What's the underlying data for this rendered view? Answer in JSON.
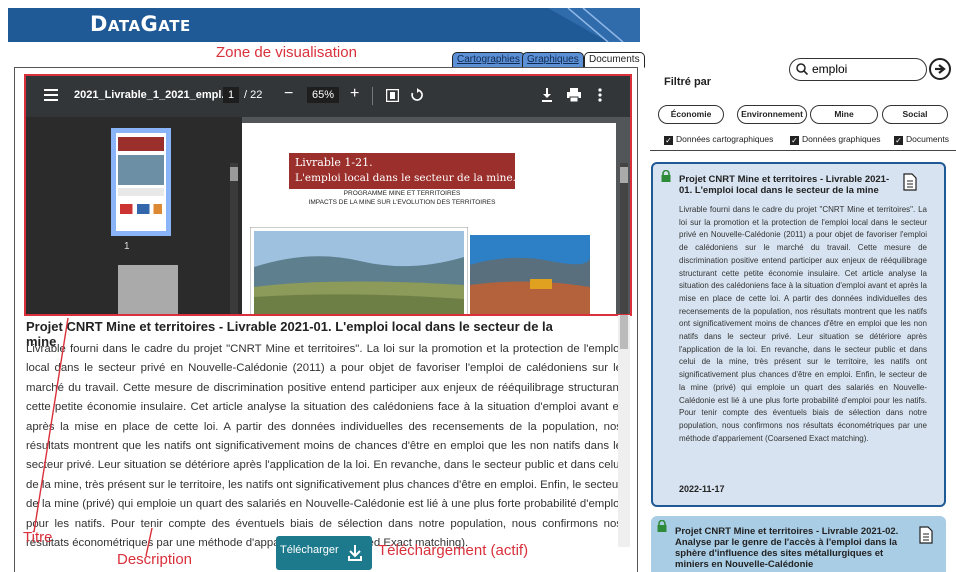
{
  "header": {
    "logo": "DataGate"
  },
  "tabs": [
    {
      "label": "Cartographies"
    },
    {
      "label": "Graphiques"
    },
    {
      "label": "Documents"
    }
  ],
  "annotations": {
    "zone": "Zone de visualisation",
    "titre": "Titre",
    "description": "Description",
    "telechargement": "Téléchargement (actif)"
  },
  "pdf_viewer": {
    "menu_icon": "hamburger-icon",
    "filename": "2021_Livrable_1_2021_empl...",
    "page_current": "1",
    "page_total": "/ 22",
    "zoom": "65%",
    "thumbnail_page": "1",
    "page_banner_line1": "Livrable 1-21.",
    "page_banner_line2": "L'emploi local dans le secteur de la mine.",
    "page_sub1": "PROGRAMME MINE ET TERRITOIRES",
    "page_sub2": "IMPACTS DE LA MINE SUR L'EVOLUTION DES TERRITOIRES",
    "banner_color": "#9b2f2c"
  },
  "document": {
    "title": "Projet CNRT Mine et territoires - Livrable 2021-01. L'emploi local dans le secteur de la mine",
    "description": "Livrable fourni dans le cadre du projet \"CNRT Mine et territoires\". La loi sur la promotion et la protection de l'emploi local dans le secteur privé en Nouvelle-Calédonie (2011) a pour objet de favoriser l'emploi de calédoniens sur le marché du travail. Cette mesure de discrimination positive entend participer aux enjeux de rééquilibrage structurant cette petite économie insulaire. Cet article analyse la situation des calédoniens face à la situation d'emploi avant et après la mise en place de cette loi. A partir des données individuelles des recensements de la population, nos résultats montrent que les natifs ont significativement moins de chances d'être en emploi que les non natifs dans le secteur privé. Leur situation se détériore après l'application de la loi. En revanche, dans le secteur public et dans celui de la mine, très présent sur le territoire, les natifs ont significativement plus chances d'être en emploi. Enfin, le secteur de la mine (privé) qui emploie un quart des salariés en Nouvelle-Calédonie est lié à une plus forte probabilité d'emploi pour les natifs. Pour tenir compte des éventuels biais de sélection dans notre population, nous confirmons nos résultats économétriques par une méthode d'appariement (Coarsened Exact matching).",
    "download_label": "Télécharger"
  },
  "search": {
    "value": "emploi",
    "placeholder": ""
  },
  "filter": {
    "label": "Filtré par",
    "pills": [
      "Économie",
      "Environnement",
      "Mine",
      "Social"
    ],
    "checkboxes": [
      "Données cartographiques",
      "Données graphiques",
      "Documents"
    ]
  },
  "results": [
    {
      "title": "Projet CNRT Mine et territoires - Livrable 2021-01. L'emploi local dans le secteur de la mine",
      "description": "Livrable fourni dans le cadre du projet \"CNRT Mine et territoires\". La loi sur la promotion et la protection de l'emploi local dans le secteur privé en Nouvelle-Calédonie (2011) a pour objet de favoriser l'emploi de calédoniens sur le marché du travail. Cette mesure de discrimination positive entend participer aux enjeux de rééquilibrage structurant cette petite économie insulaire. Cet article analyse la situation des calédoniens face à la situation d'emploi avant et après la mise en place de cette loi. A partir des données individuelles des recensements de la population, nos résultats montrent que les natifs ont significativement moins de chances d'être en emploi que les non natifs dans le secteur privé. Leur situation se détériore après l'application de la loi. En revanche, dans le secteur public et dans celui de la mine, très présent sur le territoire, les natifs ont significativement plus chances d'être en emploi. Enfin, le secteur de la mine (privé) qui emploie un quart des salariés en Nouvelle-Calédonie est lié à une plus forte probabilité d'emploi pour les natifs. Pour tenir compte des éventuels biais de sélection dans notre population, nous confirmons nos résultats économétriques par une méthode d'appariement (Coarsened Exact matching).",
      "date": "2022-11-17"
    },
    {
      "title": "Projet CNRT Mine et territoires - Livrable 2021-02. Analyse par le genre de l'accès à l'emploi dans la sphère d'influence des sites métallurgiques et miniers en Nouvelle-Calédonie"
    }
  ],
  "colors": {
    "header_bg": "#1f5a96",
    "accent_red": "#d9303b",
    "download_btn": "#1d7a8c",
    "card_active_bg": "#d7e3f0",
    "card_bg": "#aacde6",
    "lock": "#2e8b3a"
  }
}
